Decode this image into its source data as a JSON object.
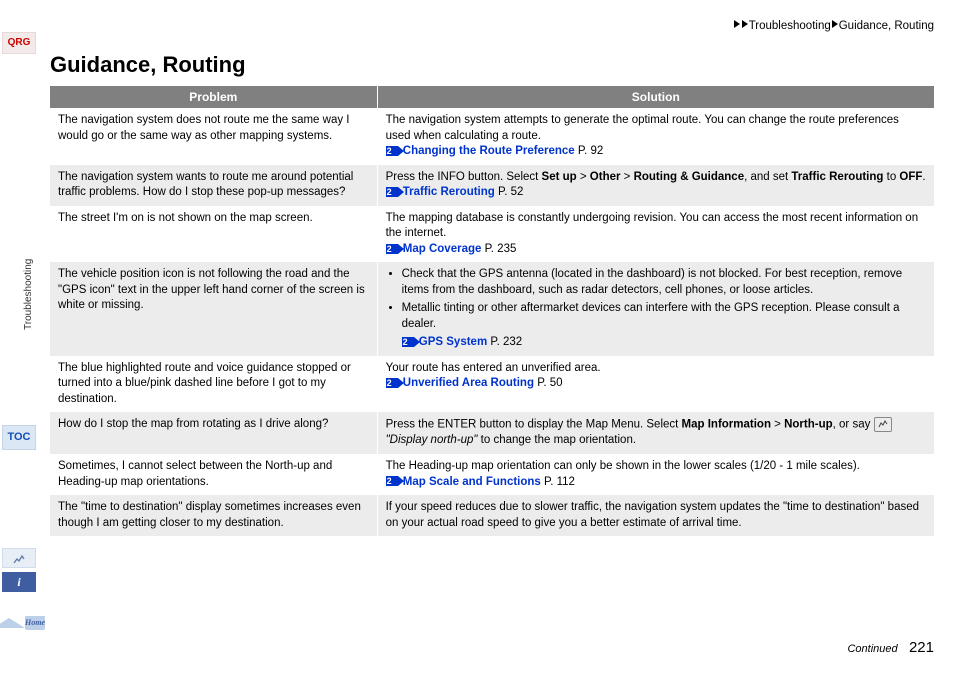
{
  "breadcrumb": {
    "level1": "Troubleshooting",
    "level2": "Guidance, Routing"
  },
  "title": "Guidance, Routing",
  "sidebar": {
    "qrg": "QRG",
    "section": "Troubleshooting",
    "toc": "TOC",
    "info_glyph": "i",
    "home": "Home"
  },
  "headers": {
    "problem": "Problem",
    "solution": "Solution"
  },
  "rows": [
    {
      "problem": "The navigation system does not route me the same way I would go or the same way as other mapping systems.",
      "solution_text": "The navigation system attempts to generate the optimal route. You can change the route preferences used when calculating a route.",
      "link": "Changing the Route Preference",
      "page": "P. 92"
    },
    {
      "problem": "The navigation system wants to route me around potential traffic problems. How do I stop these pop-up messages?",
      "solution_pre": "Press the INFO button. Select ",
      "setup": "Set up",
      "gt1": " > ",
      "other": "Other",
      "gt2": " > ",
      "rg": "Routing & Guidance",
      "andset": ", and set ",
      "tr": "Traffic Rerouting",
      "tooff": " to ",
      "off": "OFF",
      "dot": ".",
      "link": "Traffic Rerouting",
      "page": "P. 52"
    },
    {
      "problem": "The street I'm on is not shown on the map screen.",
      "solution_text": "The mapping database is constantly undergoing revision. You can access the most recent information on the internet.",
      "link": "Map Coverage",
      "page": "P. 235"
    },
    {
      "problem": "The vehicle position icon is not following the road and the \"GPS icon\" text in the upper left hand corner of the screen is white or missing.",
      "bullets": [
        "Check that the GPS antenna (located in the dashboard) is not blocked. For best reception, remove items from the dashboard, such as radar detectors, cell phones, or loose articles.",
        "Metallic tinting or other aftermarket devices can interfere with the GPS reception. Please consult a dealer."
      ],
      "link": "GPS System",
      "page": "P. 232"
    },
    {
      "problem": "The blue highlighted route and voice guidance stopped or turned into a blue/pink dashed line before I got to my destination.",
      "solution_text": "Your route has entered an unverified area.",
      "link": "Unverified Area Routing",
      "page": "P. 50"
    },
    {
      "problem": "How do I stop the map from rotating as I drive along?",
      "sol_pre": "Press the ENTER button to display the Map Menu. Select ",
      "mi": "Map Information",
      "gt": " > ",
      "nu": "North-up",
      "orsay": ", or say ",
      "voice_cmd": "\"Display north-up\"",
      "tail": " to change the map orientation."
    },
    {
      "problem": "Sometimes, I cannot select between the North-up and Heading-up map orientations.",
      "solution_text": "The Heading-up map orientation can only be shown in the lower scales (1/20 - 1 mile scales).",
      "link": "Map Scale and Functions",
      "page": "P. 112"
    },
    {
      "problem": "The \"time to destination\" display sometimes increases even though I am getting closer to my destination.",
      "solution_text": "If your speed reduces due to slower traffic, the navigation system updates the \"time to destination\" based on your actual road speed to give you a better estimate of arrival time."
    }
  ],
  "footer": {
    "continued": "Continued",
    "page": "221"
  }
}
